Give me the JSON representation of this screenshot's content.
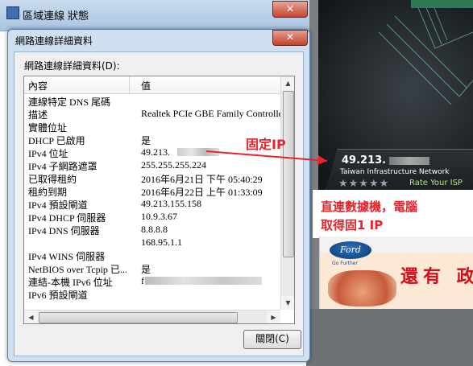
{
  "background_window": {
    "title": "區域連線 狀態",
    "close_glyph": "✕"
  },
  "dialog": {
    "title": "網路連線詳細資料",
    "close_glyph": "✕",
    "section_label": "網路連線詳細資料(D):",
    "columns": [
      "內容",
      "值"
    ],
    "rows": [
      {
        "key": "連線特定 DNS 尾碼",
        "value": ""
      },
      {
        "key": "描述",
        "value": "Realtek PCIe GBE Family Controller"
      },
      {
        "key": "實體位址",
        "value": ""
      },
      {
        "key": "DHCP 已啟用",
        "value": "是"
      },
      {
        "key": "IPv4 位址",
        "value": "49.213."
      },
      {
        "key": "IPv4 子網路遮罩",
        "value": "255.255.255.224"
      },
      {
        "key": "已取得租約",
        "value": "2016年6月21日 下午 05:40:29"
      },
      {
        "key": "租約到期",
        "value": "2016年6月22日 上午 01:33:09"
      },
      {
        "key": "IPv4 預設閘道",
        "value": "49.213.155.158"
      },
      {
        "key": "IPv4 DHCP 伺服器",
        "value": "10.9.3.67"
      },
      {
        "key": "IPv4 DNS 伺服器",
        "value": "8.8.8.8"
      },
      {
        "key": "",
        "value": "168.95.1.1"
      },
      {
        "key": "IPv4 WINS 伺服器",
        "value": ""
      },
      {
        "key": "NetBIOS over Tcpip 已...",
        "value": "是"
      },
      {
        "key": "連結-本機 IPv6 位址",
        "value": "f"
      },
      {
        "key": "IPv6 預設閘道",
        "value": ""
      }
    ],
    "close_button": "關閉(C)"
  },
  "speedtest": {
    "ip": "49.213.",
    "isp": "Taiwan Infrastructure Network",
    "rate_label": "Rate Your ISP",
    "stars": "★★★★★"
  },
  "ad": {
    "brand": "Ford",
    "tagline": "Go Further",
    "headline": "還有 政"
  },
  "annotations": {
    "fixed_ip": "固定IP",
    "note_line1": "直連數據機，電腦",
    "note_line2": "取得固1 IP"
  },
  "colors": {
    "annotation_red": "#e8232a",
    "dialog_frame": "#cfe0f1"
  }
}
